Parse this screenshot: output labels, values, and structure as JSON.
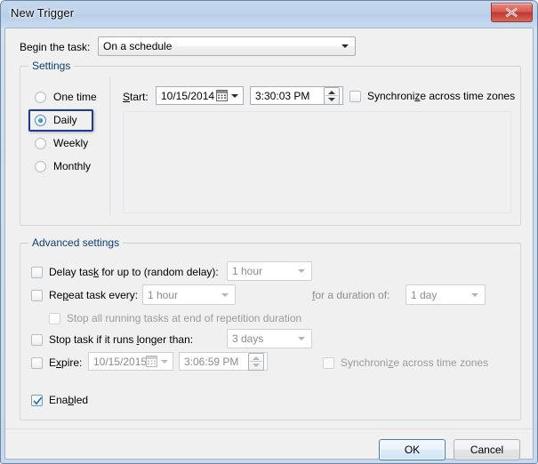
{
  "window": {
    "title": "New Trigger",
    "close_label": "Close",
    "close_icon": "close-icon"
  },
  "begin": {
    "label": "Begin the task:",
    "value": "On a schedule",
    "arrow_icon": "chevron-down-icon"
  },
  "settings": {
    "group_title": "Settings",
    "radios": [
      {
        "label": "One time",
        "checked": false
      },
      {
        "label": "Daily",
        "checked": true
      },
      {
        "label": "Weekly",
        "checked": false
      },
      {
        "label": "Monthly",
        "checked": false
      }
    ],
    "start_label": "Start:",
    "start_date": "10/15/2014",
    "start_time": "3:30:03 PM",
    "calendar_icon": "calendar-icon",
    "spinner_icon": "spinner-up-down-icon",
    "sync_label": "Synchronize across time zones",
    "sync_checked": false
  },
  "advanced": {
    "group_title": "Advanced settings",
    "delay": {
      "label": "Delay task for up to (random delay):",
      "checked": false,
      "value": "1 hour",
      "enabled": false
    },
    "repeat": {
      "label": "Repeat task every:",
      "checked": false,
      "value": "1 hour",
      "enabled": false,
      "duration_label": "for a duration of:",
      "duration_value": "1 day"
    },
    "stop_all": {
      "label": "Stop all running tasks at end of repetition duration",
      "checked": false,
      "enabled": false
    },
    "stop_longer": {
      "label": "Stop task if it runs longer than:",
      "checked": false,
      "value": "3 days",
      "enabled": false
    },
    "expire": {
      "label": "Expire:",
      "checked": false,
      "date": "10/15/2015",
      "time": "3:06:59 PM",
      "sync_label": "Synchronize across time zones",
      "sync_checked": false,
      "enabled": false
    },
    "enabled": {
      "label": "Enabled",
      "checked": true
    }
  },
  "buttons": {
    "ok": "OK",
    "cancel": "Cancel"
  },
  "colors": {
    "titlebar": "#bdd2ea",
    "close_red": "#c0362d",
    "group_title": "#0b3d73",
    "focus_outline": "#1f3a93",
    "default_button_border": "#3c7fb1",
    "dialog_bg": "#f0f0f0",
    "disabled_text": "#8c8c8c"
  }
}
